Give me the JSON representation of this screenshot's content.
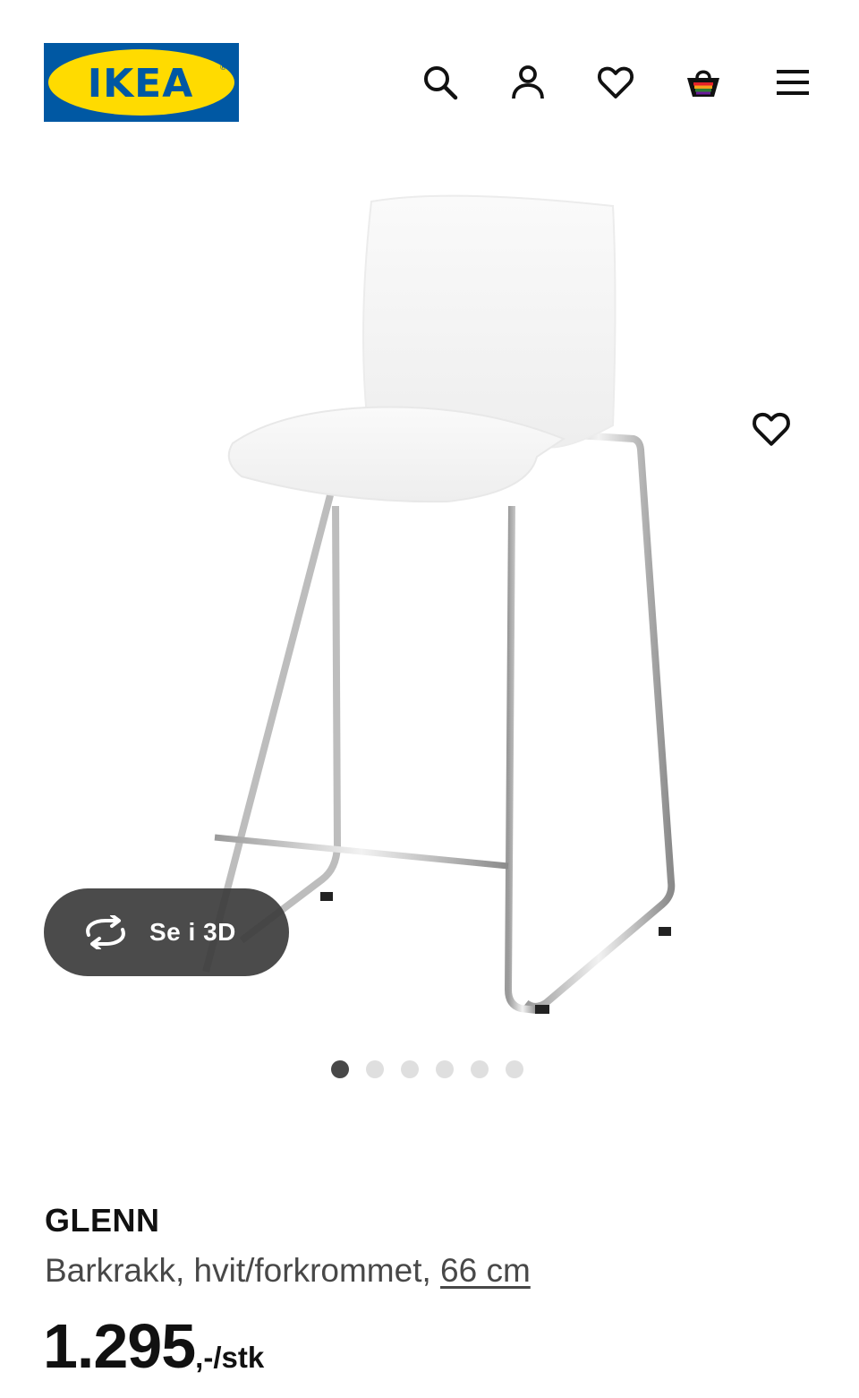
{
  "header": {
    "logo_text": "IKEA",
    "icons": [
      "search-icon",
      "account-icon",
      "heart-icon",
      "basket-icon",
      "menu-icon"
    ]
  },
  "gallery": {
    "button_3d_label": "Se i 3D",
    "slide_count": 6,
    "active_slide": 1
  },
  "product": {
    "name": "GLENN",
    "description": "Barkrakk, hvit/forkrommet, ",
    "size": "66 cm",
    "price": "1.295",
    "price_suffix": ",-/stk"
  },
  "colors": {
    "ikea_blue": "#0058A3",
    "ikea_yellow": "#FFDB00",
    "button_dark": "#3C3C3C",
    "dot_active": "#484848",
    "dot_inactive": "#DFDFDF"
  }
}
